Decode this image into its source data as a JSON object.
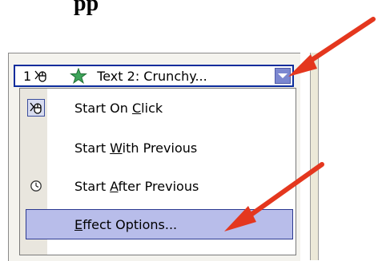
{
  "heading": "pp",
  "animation_item": {
    "order": "1",
    "text": "Text 2: Crunchy..."
  },
  "menu": {
    "items": [
      {
        "pre": "Start On ",
        "hot": "C",
        "post": "lick",
        "checked": true
      },
      {
        "pre": "Start ",
        "hot": "W",
        "post": "ith Previous"
      },
      {
        "pre": "Start ",
        "hot": "A",
        "post": "fter Previous"
      },
      {
        "pre": "",
        "hot": "E",
        "post": "ffect Options..."
      }
    ]
  },
  "colors": {
    "selection_border": "#0b2c9c",
    "highlight_fill": "#b8bdea",
    "arrow": "#e4371e"
  }
}
